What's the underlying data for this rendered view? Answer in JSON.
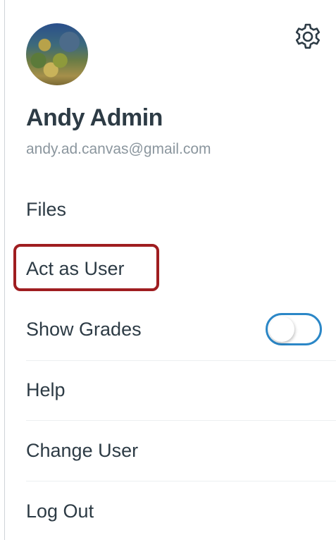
{
  "profile": {
    "name": "Andy Admin",
    "email": "andy.ad.canvas@gmail.com",
    "avatar_icon": "avatar-photo",
    "settings_icon": "gear-icon"
  },
  "menu": {
    "files": "Files",
    "act_as_user": "Act as User",
    "show_grades": "Show Grades",
    "help": "Help",
    "change_user": "Change User",
    "log_out": "Log Out"
  },
  "toggle": {
    "show_grades_on": false,
    "accent": "#2b87c7"
  },
  "colors": {
    "highlight": "#9f1d20",
    "text": "#2d3b45",
    "muted": "#8b969e"
  }
}
